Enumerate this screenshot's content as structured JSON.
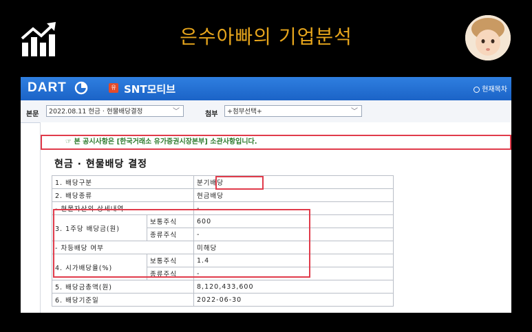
{
  "banner": {
    "title": "은수아빠의 기업분석",
    "logo_icon": "rising-chart-icon",
    "avatar_icon": "child-portrait-icon",
    "accent": "#e6a51c"
  },
  "dart": {
    "logo_text": "DART",
    "corp_badge": "유",
    "corp_name": "SNT모티브",
    "current_notice": "현재목차"
  },
  "select_bar": {
    "main_label": "본문",
    "main_value": "2022.08.11  현금 · 현물배당결정",
    "attach_label": "첨부",
    "attach_value": "+첨부선택+"
  },
  "doc": {
    "notice": "☞ 본 공시사항은 [한국거래소 유가증권시장본부] 소관사항입니다.",
    "title": "현금 · 현물배당 결정",
    "rows": {
      "r1": {
        "label": "1. 배당구분",
        "value": "분기배당"
      },
      "r2": {
        "label": "2. 배당종류",
        "value": "현금배당"
      },
      "r3": {
        "label": "- 현물자산의 상세내역",
        "value": "-"
      },
      "r4": {
        "label": "3. 1주당 배당금(원)",
        "sub1": "보통주식",
        "val1": "600",
        "sub2": "종류주식",
        "val2": "-"
      },
      "r5": {
        "label": "- 차등배당 여부",
        "value": "미해당"
      },
      "r6": {
        "label": "4. 시가배당율(%)",
        "sub1": "보통주식",
        "val1": "1.4",
        "sub2": "종류주식",
        "val2": "-"
      },
      "r7": {
        "label": "5. 배당금총액(원)",
        "value": "8,120,433,600"
      },
      "r8": {
        "label": "6. 배당기준일",
        "value": "2022-06-30"
      }
    }
  }
}
